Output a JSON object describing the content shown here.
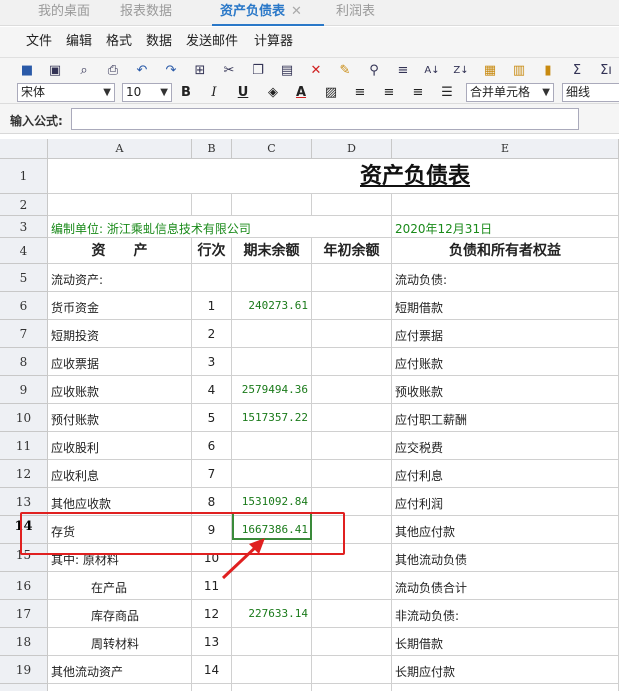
{
  "tabs": [
    {
      "label": "我的桌面"
    },
    {
      "label": "报表数据"
    },
    {
      "label": "资产负债表",
      "close": "✕"
    },
    {
      "label": "利润表"
    }
  ],
  "menu": [
    "文件",
    "编辑",
    "格式",
    "数据",
    "发送邮件",
    "计算器"
  ],
  "toolbar": {
    "font": "宋体",
    "size": "10",
    "merge": "合并单元格",
    "border": "细线",
    "bold": "B",
    "italic": "I",
    "underline": "U",
    "fontcolor": "A"
  },
  "formula": {
    "label": "输入公式:",
    "value": ""
  },
  "columns": [
    "A",
    "B",
    "C",
    "D",
    "E"
  ],
  "rows": [
    "1",
    "2",
    "3",
    "4",
    "5",
    "6",
    "7",
    "8",
    "9",
    "10",
    "11",
    "12",
    "13",
    "14",
    "15",
    "16",
    "17",
    "18",
    "19"
  ],
  "sheet": {
    "title": "资产负债表",
    "company": "编制单位: 浙江乘虬信息技术有限公司",
    "date": "2020年12月31日",
    "headers": {
      "assets": "资　　产",
      "line": "行次",
      "end": "期末余额",
      "begin": "年初余额",
      "liab": "负债和所有者权益"
    },
    "body": [
      {
        "a": "流动资产:",
        "b": "",
        "c": "",
        "e": "流动负债:"
      },
      {
        "a": "货币资金",
        "b": "1",
        "c": "240273.61",
        "e": "短期借款"
      },
      {
        "a": "短期投资",
        "b": "2",
        "c": "",
        "e": "应付票据"
      },
      {
        "a": "应收票据",
        "b": "3",
        "c": "",
        "e": "应付账款"
      },
      {
        "a": "应收账款",
        "b": "4",
        "c": "2579494.36",
        "e": "预收账款"
      },
      {
        "a": "预付账款",
        "b": "5",
        "c": "1517357.22",
        "e": "应付职工薪酬"
      },
      {
        "a": "应收股利",
        "b": "6",
        "c": "",
        "e": "应交税费"
      },
      {
        "a": "应收利息",
        "b": "7",
        "c": "",
        "e": "应付利息"
      },
      {
        "a": "其他应收款",
        "b": "8",
        "c": "1531092.84",
        "e": "应付利润"
      },
      {
        "a": "存货",
        "b": "9",
        "c": "1667386.41",
        "e": "其他应付款"
      },
      {
        "a": "其中: 原材料",
        "b": "10",
        "c": "",
        "e": "其他流动负债"
      },
      {
        "a": "在产品",
        "b": "11",
        "c": "",
        "e": "流动负债合计"
      },
      {
        "a": "库存商品",
        "b": "12",
        "c": "227633.14",
        "e": "非流动负债:"
      },
      {
        "a": "周转材料",
        "b": "13",
        "c": "",
        "e": "长期借款"
      },
      {
        "a": "其他流动资产",
        "b": "14",
        "c": "",
        "e": "长期应付款"
      }
    ]
  },
  "colors": {
    "accent": "#2a78c8",
    "number": "#1a7a1a",
    "highlight": "#e02020"
  }
}
